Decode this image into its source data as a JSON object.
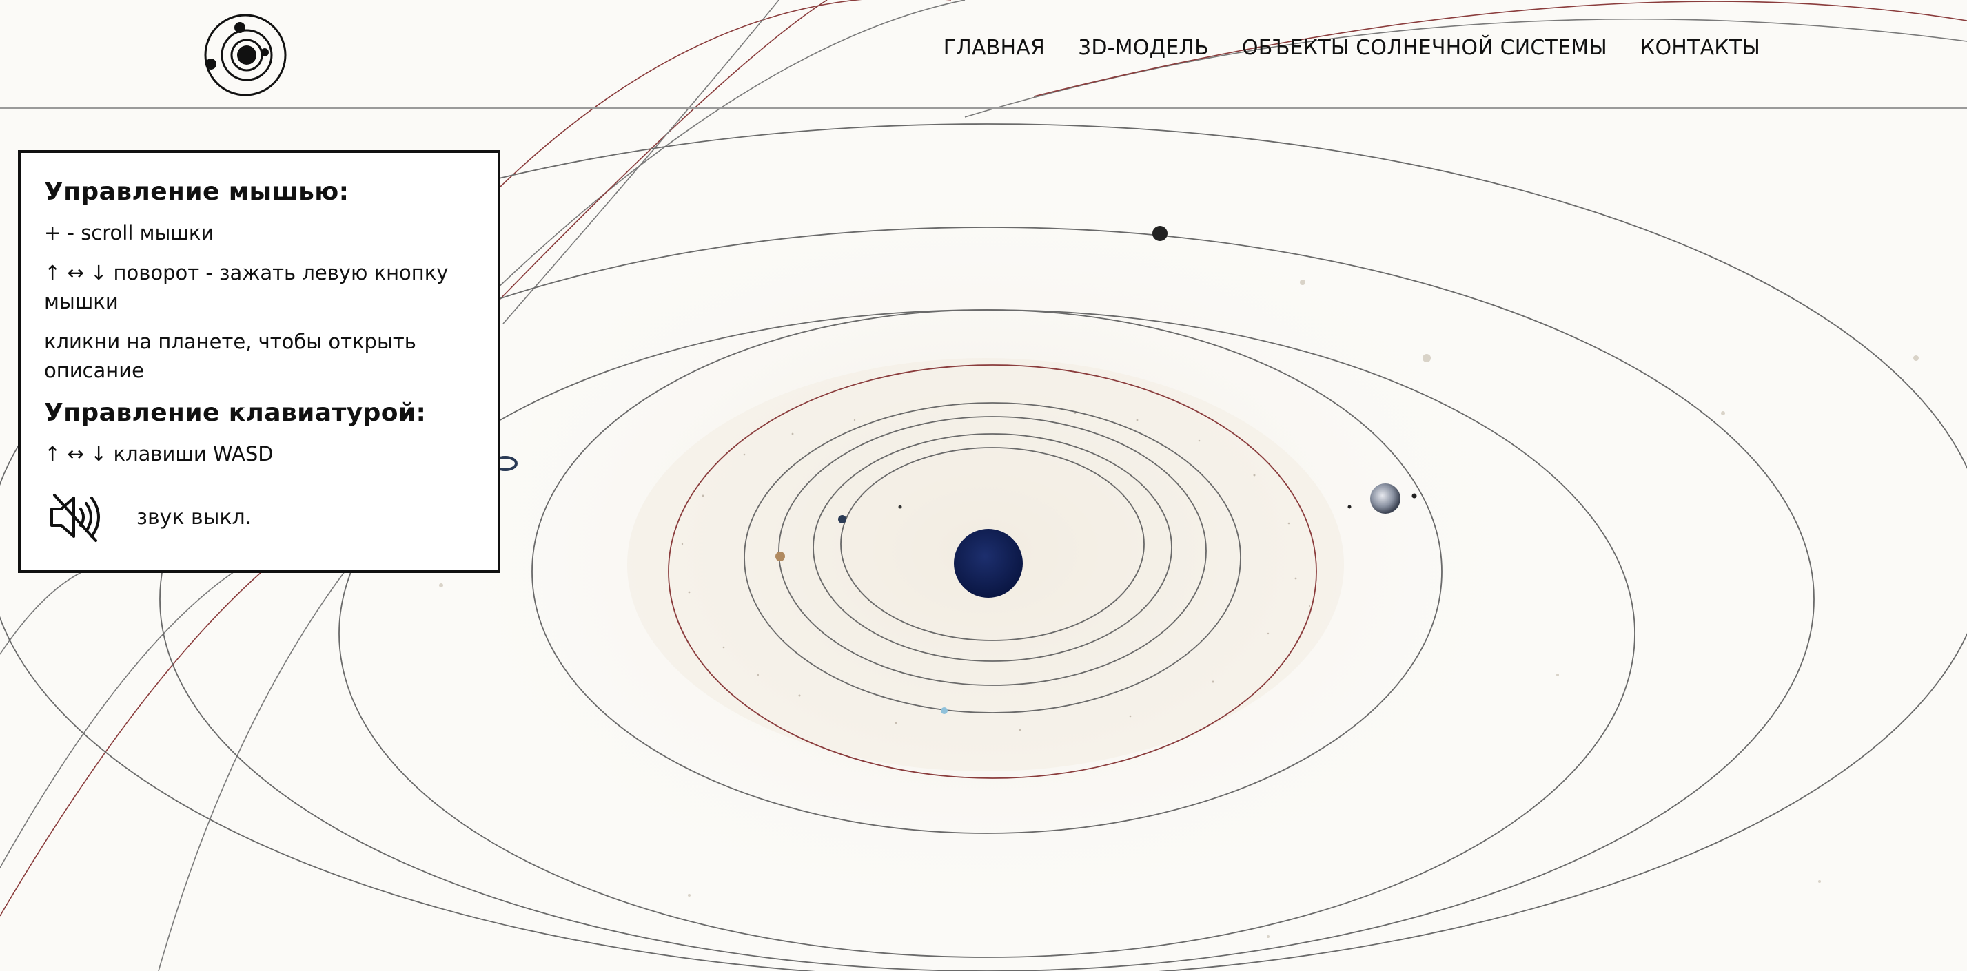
{
  "nav": {
    "items": [
      {
        "label": "ГЛАВНАЯ"
      },
      {
        "label": "3D-МОДЕЛЬ"
      },
      {
        "label": "ОБЪЕКТЫ СОЛНЕЧНОЙ СИСТЕМЫ"
      },
      {
        "label": "КОНТАКТЫ"
      }
    ]
  },
  "controls": {
    "mouse_title": "Управление мышью:",
    "mouse_zoom": "+ - scroll мышки",
    "mouse_rotate": "↑ ↔ ↓ поворот - зажать левую кнопку мышки",
    "mouse_click": "кликни на планете, чтобы открыть описание",
    "keyboard_title": "Управление клавиатурой:",
    "keyboard_keys": "↑ ↔ ↓ клавиши WASD",
    "sound_label": "звук выкл."
  },
  "icons": {
    "logo": "solar-system-logo-icon",
    "sound": "sound-off-icon"
  },
  "colors": {
    "background": "#fbfaf7",
    "orbit_gray": "#6a6a6a",
    "orbit_red": "#8a3c3c",
    "sun": "#0e1d52",
    "panel_border": "#111111"
  }
}
